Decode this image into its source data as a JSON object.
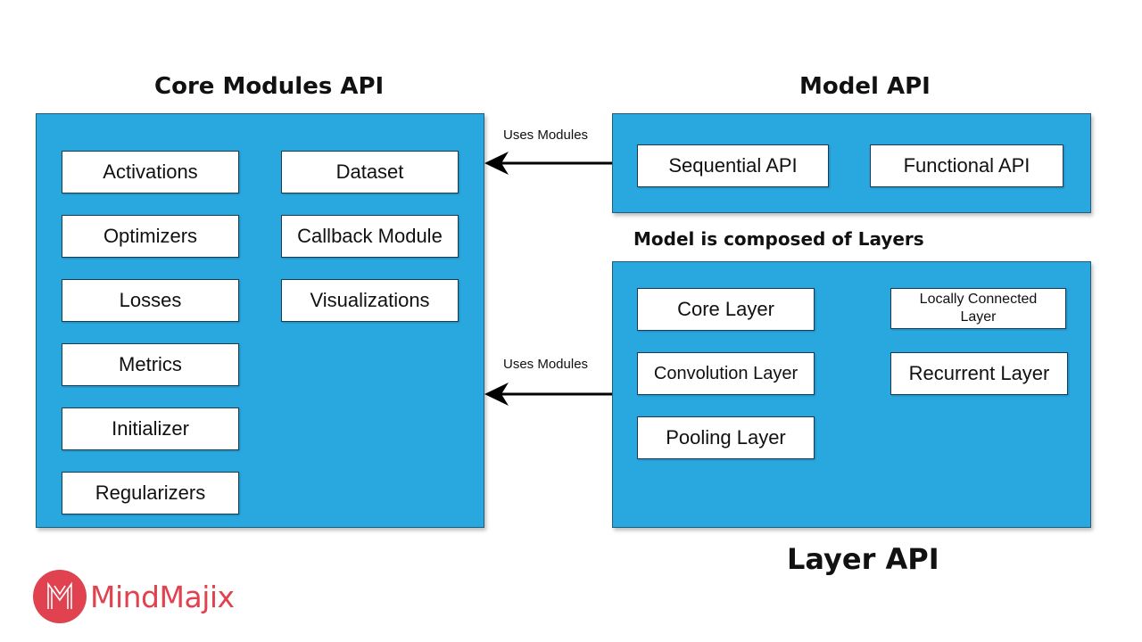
{
  "diagram": {
    "core_modules": {
      "title": "Core Modules API",
      "left_column": [
        "Activations",
        "Optimizers",
        "Losses",
        "Metrics",
        "Initializer",
        "Regularizers"
      ],
      "right_column": [
        "Dataset",
        "Callback Module",
        "Visualizations"
      ]
    },
    "model_api": {
      "title": "Model API",
      "items": [
        "Sequential API",
        "Functional API"
      ]
    },
    "layer_api": {
      "title": "Layer API",
      "caption": "Model is composed of Layers",
      "left_column": [
        "Core Layer",
        "Convolution Layer",
        "Pooling Layer"
      ],
      "right_column": [
        "Locally Connected Layer",
        "Recurrent Layer"
      ]
    },
    "edges": [
      {
        "from": "Model API",
        "to": "Core Modules API",
        "label": "Uses Modules"
      },
      {
        "from": "Layer API",
        "to": "Core Modules API",
        "label": "Uses Modules"
      }
    ],
    "colors": {
      "panel": "#29a8e0",
      "brand": "#e0434f"
    }
  },
  "brand": {
    "name": "MindMajix",
    "icon": "mindmajix-logo-icon"
  }
}
